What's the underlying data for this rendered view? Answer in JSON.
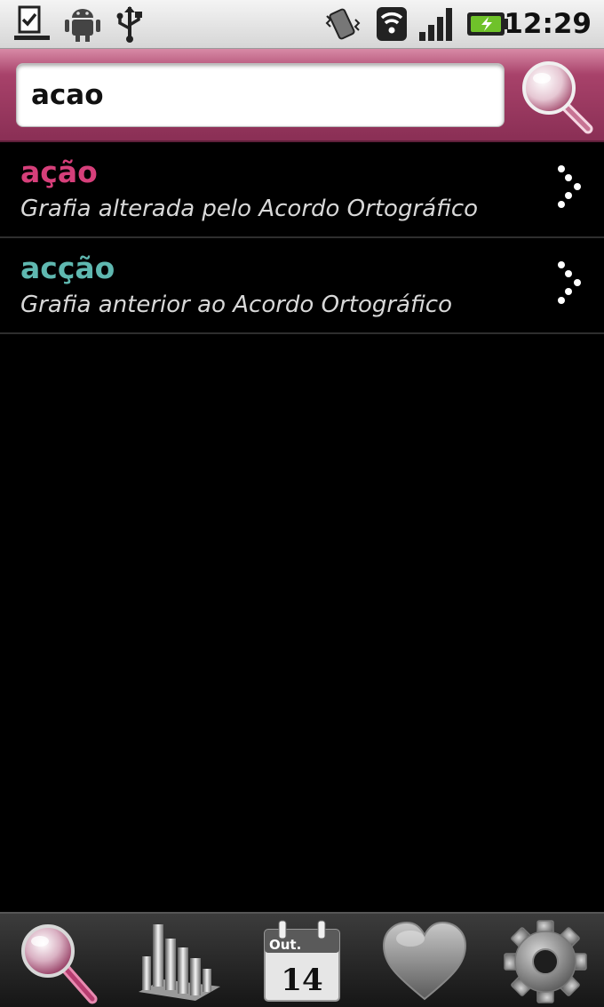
{
  "status_bar": {
    "time": "12:29",
    "icons": [
      "download-done-icon",
      "android-debug-icon",
      "usb-icon",
      "vibrate-icon",
      "wifi-icon",
      "signal-icon",
      "battery-charging-icon"
    ]
  },
  "search": {
    "value": "acao",
    "button_icon": "magnifier-icon"
  },
  "results": [
    {
      "word": "ação",
      "description": "Grafia alterada pelo Acordo Ortográfico",
      "color": "#d63f7a"
    },
    {
      "word": "acção",
      "description": "Grafia anterior ao Acordo Ortográfico",
      "color": "#5fb8b0"
    }
  ],
  "toolbar": {
    "calendar_month": "Out.",
    "calendar_day": "14",
    "icons": [
      "search-tab-icon",
      "statistics-tab-icon",
      "calendar-tab-icon",
      "favorites-tab-icon",
      "settings-tab-icon"
    ]
  },
  "colors": {
    "accent": "#a8426a",
    "word_new": "#d63f7a",
    "word_old": "#5fb8b0"
  }
}
